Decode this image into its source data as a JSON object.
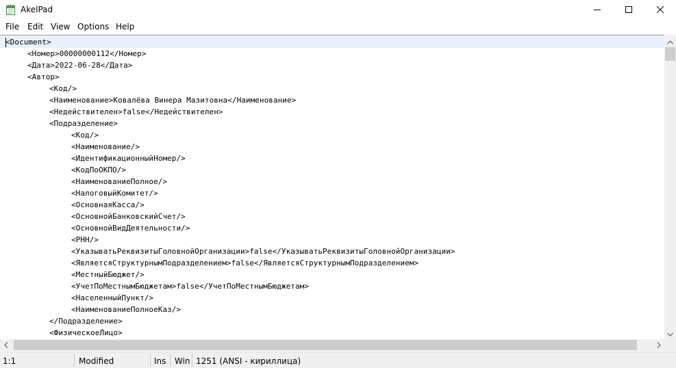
{
  "window": {
    "title": "AkelPad",
    "icon": "notepad-icon",
    "controls": [
      "minimize-icon",
      "maximize-icon",
      "close-icon"
    ]
  },
  "menu": [
    "File",
    "Edit",
    "View",
    "Options",
    "Help"
  ],
  "editor": {
    "lines": [
      {
        "indent": 0,
        "text": "<Document>"
      },
      {
        "indent": 1,
        "text": "<Номер>00000000112</Номер>"
      },
      {
        "indent": 1,
        "text": "<Дата>2022-06-28</Дата>"
      },
      {
        "indent": 1,
        "text": "<Автор>"
      },
      {
        "indent": 2,
        "text": "<Код/>"
      },
      {
        "indent": 2,
        "text": "<Наименование>Ковалёва Винера Мазитовна</Наименование>"
      },
      {
        "indent": 2,
        "text": "<Недействителен>false</Недействителен>"
      },
      {
        "indent": 2,
        "text": "<Подразделение>"
      },
      {
        "indent": 3,
        "text": "<Код/>"
      },
      {
        "indent": 3,
        "text": "<Наименование/>"
      },
      {
        "indent": 3,
        "text": "<ИдентификационныйНомер/>"
      },
      {
        "indent": 3,
        "text": "<КодПоОКПО/>"
      },
      {
        "indent": 3,
        "text": "<НаименованиеПолное/>"
      },
      {
        "indent": 3,
        "text": "<НалоговыйКомитет/>"
      },
      {
        "indent": 3,
        "text": "<ОсновнаяКасса/>"
      },
      {
        "indent": 3,
        "text": "<ОсновнойБанковскийСчет/>"
      },
      {
        "indent": 3,
        "text": "<ОсновнойВидДеятельности/>"
      },
      {
        "indent": 3,
        "text": "<РНН/>"
      },
      {
        "indent": 3,
        "text": "<УказыватьРеквизитыГоловнойОрганизации>false</УказыватьРеквизитыГоловнойОрганизации>"
      },
      {
        "indent": 3,
        "text": "<ЯвляетсяСтруктурнымПодразделением>false</ЯвляетсяСтруктурнымПодразделением>"
      },
      {
        "indent": 3,
        "text": "<МестныйБюджет/>"
      },
      {
        "indent": 3,
        "text": "<УчетПоМестнымБюджетам>false</УчетПоМестнымБюджетам>"
      },
      {
        "indent": 3,
        "text": "<НаселенныйПункт/>"
      },
      {
        "indent": 3,
        "text": "<НаименованиеПолноеКаз/>"
      },
      {
        "indent": 2,
        "text": "</Подразделение>"
      },
      {
        "indent": 2,
        "text": "<ФизическоеЛицо>"
      }
    ]
  },
  "status": {
    "position": "1:1",
    "modified": "Modified",
    "insert_mode": "Ins",
    "newline": "Win",
    "codepage": "1251  (ANSI - кириллица)"
  },
  "colors": {
    "current_line": "#e8f0fc",
    "scrollbar_track": "#f0f0f0",
    "scrollbar_thumb": "#cdcdcd"
  }
}
